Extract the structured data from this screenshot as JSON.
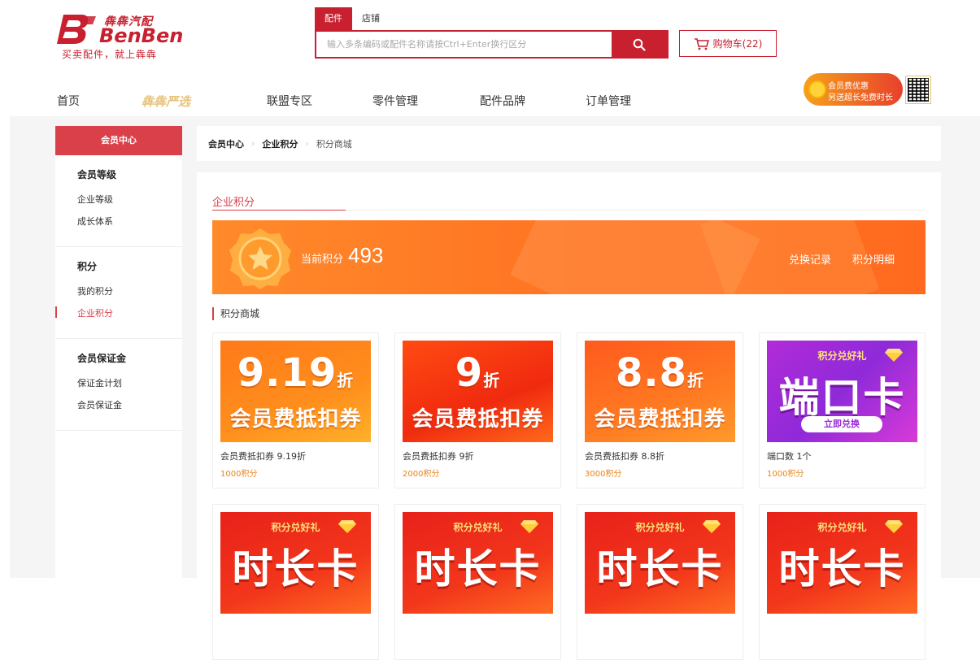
{
  "brand": {
    "name_cn": "犇犇汽配",
    "name_en": "BenBen",
    "slogan": "买卖配件，就上犇犇"
  },
  "search": {
    "tabs": [
      "配件",
      "店铺"
    ],
    "placeholder": "输入多条编码或配件名称请按Ctrl+Enter换行区分"
  },
  "cart": {
    "label": "购物车(22)"
  },
  "nav": {
    "items": [
      "首页",
      "犇犇严选",
      "联盟专区",
      "零件管理",
      "配件品牌",
      "订单管理"
    ]
  },
  "promo": {
    "line1": "会员费优惠",
    "line2": "另送超长免费时长"
  },
  "sidebar": {
    "header": "会员中心",
    "groups": [
      {
        "title": "会员等级",
        "links": [
          "企业等级",
          "成长体系"
        ]
      },
      {
        "title": "积分",
        "links": [
          "我的积分",
          "企业积分"
        ]
      },
      {
        "title": "会员保证金",
        "links": [
          "保证金计划",
          "会员保证金"
        ]
      }
    ],
    "active_link": "企业积分"
  },
  "breadcrumb": [
    "会员中心",
    "企业积分",
    "积分商城"
  ],
  "section": {
    "title": "企业积分",
    "points_label": "当前积分",
    "points_value": "493",
    "links": [
      "兑换记录",
      "积分明细"
    ],
    "shop_title": "积分商城"
  },
  "products": [
    {
      "name": "会员费抵扣券 9.19折",
      "points": "1000积分",
      "art_big": "9.19",
      "art_unit": "折",
      "art_sub": "会员费抵扣券"
    },
    {
      "name": "会员费抵扣券 9折",
      "points": "2000积分",
      "art_big": "9",
      "art_unit": "折",
      "art_sub": "会员费抵扣券"
    },
    {
      "name": "会员费抵扣券 8.8折",
      "points": "3000积分",
      "art_big": "8.8",
      "art_unit": "折",
      "art_sub": "会员费抵扣券"
    },
    {
      "name": "端口数 1个",
      "points": "1000积分",
      "art_tag": "积分兑好礼",
      "art_big": "端口卡",
      "art_btn": "立即兑换"
    }
  ],
  "products_row2": [
    {
      "art_tag": "积分兑好礼",
      "art_big": "时长卡"
    },
    {
      "art_tag": "积分兑好礼",
      "art_big": "时长卡"
    },
    {
      "art_tag": "积分兑好礼",
      "art_big": "时长卡"
    },
    {
      "art_tag": "积分兑好礼",
      "art_big": "时长卡"
    }
  ],
  "colors": {
    "brand_red": "#c8202f",
    "accent_red": "#d9404a",
    "points_orange": "#e8831a",
    "banner_orange": "#ff7322"
  }
}
